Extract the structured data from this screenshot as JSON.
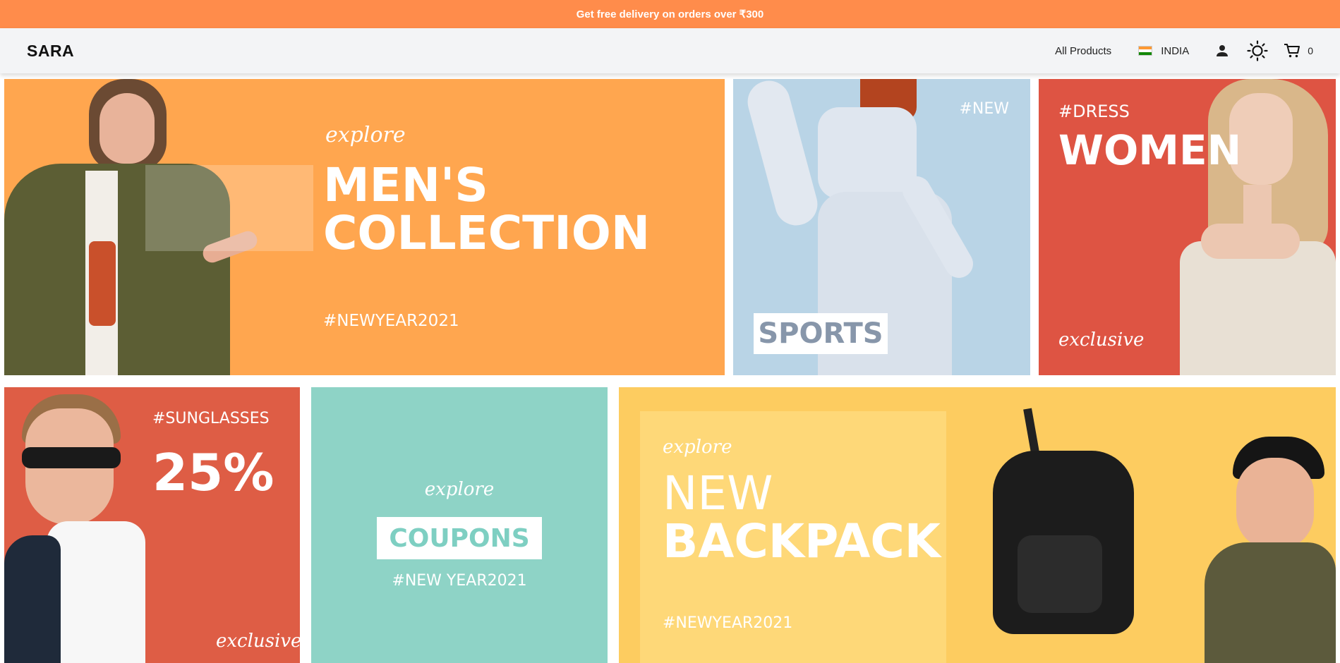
{
  "promo": {
    "text": "Get free delivery on orders over ₹300"
  },
  "header": {
    "logo": "SARA",
    "nav_all_products": "All Products",
    "country": "INDIA",
    "cart_count": "0",
    "icons": {
      "account": "user-icon",
      "theme": "sun-icon",
      "cart": "cart-icon",
      "flag": "india-flag-icon"
    }
  },
  "banners": {
    "mens": {
      "explore": "explore",
      "line1": "MEN'S",
      "line2": "COLLECTION",
      "tag": "#NEWYEAR2021",
      "bg": "#ffa64f"
    },
    "sports": {
      "tag": "#NEW",
      "label": "SPORTS",
      "bg": "#b9d4e6"
    },
    "women": {
      "tag": "#DRESS",
      "title": "WOMEN",
      "sub": "exclusive",
      "bg": "#de5443"
    },
    "sunglasses": {
      "tag": "#SUNGLASSES",
      "title": "25%",
      "sub": "exclusive",
      "bg": "#de5d45"
    },
    "coupons": {
      "explore": "explore",
      "label": "COUPONS",
      "tag": "#NEW YEAR2021",
      "bg": "#8ed3c6"
    },
    "backpack": {
      "explore": "explore",
      "line1": "NEW",
      "line2": "BACKPACK",
      "tag": "#NEWYEAR2021",
      "bg": "#fdcc60"
    }
  }
}
